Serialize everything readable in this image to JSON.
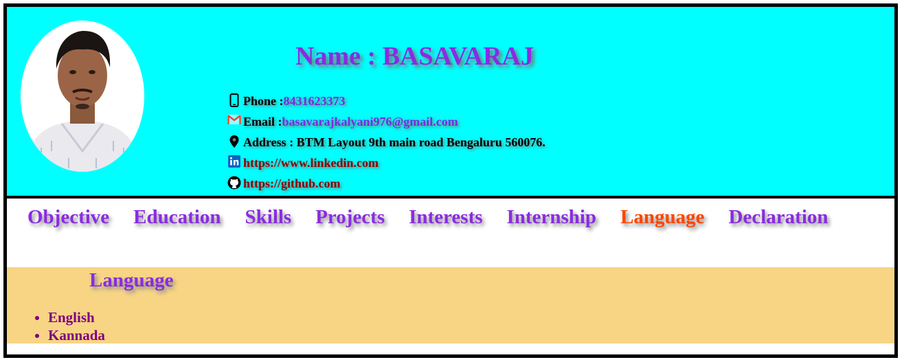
{
  "header": {
    "name": "Name : BASAVARAJ",
    "contacts": {
      "phone_label": "Phone : ",
      "phone_value": "8431623373",
      "email_label": "Email : ",
      "email_value": "basavarajkalyani976@gmail.com",
      "address": "Address : BTM Layout 9th main road Bengaluru 560076.",
      "linkedin": "https://www.linkedin.com",
      "github": "https://github.com"
    },
    "icons": [
      "phone-icon",
      "gmail-icon",
      "location-icon",
      "linkedin-icon",
      "github-icon"
    ]
  },
  "nav": {
    "items": [
      "Objective",
      "Education",
      "Skills",
      "Projects",
      "Interests",
      "Internship",
      "Language",
      "Declaration"
    ],
    "active": "Language"
  },
  "section": {
    "title": "Language",
    "items": [
      "English",
      "Kannada"
    ]
  },
  "colors": {
    "header_bg": "#00ffff",
    "section_bg": "#f7d585",
    "accent": "#8a2be2",
    "active": "#ff4500",
    "list_text": "#800080"
  }
}
